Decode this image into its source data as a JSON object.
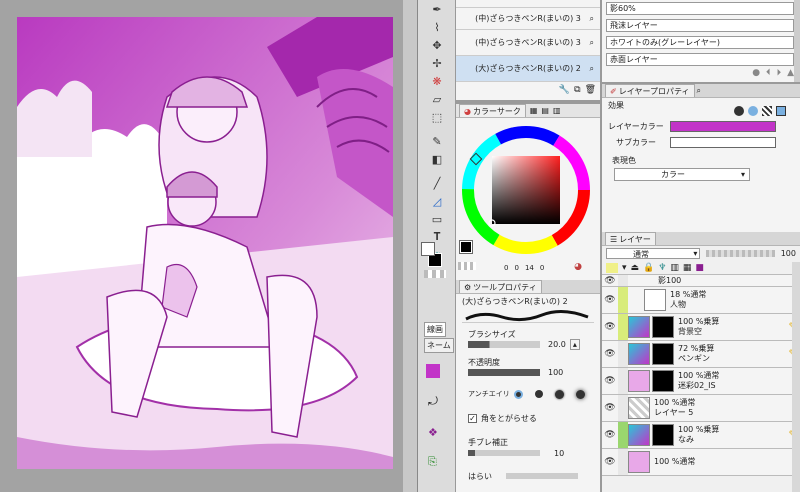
{
  "brush_list": {
    "items": [
      {
        "label": "(中)ざらつきペンR(まいの) 3"
      },
      {
        "label": "(大)ざらつきペンR(まいの) 2"
      }
    ]
  },
  "material_list": {
    "items": [
      "影60%",
      "飛沫レイヤー",
      "ホワイトのみ(グレーレイヤー)",
      "赤面レイヤー"
    ]
  },
  "color_circle": {
    "tab": "カラーサーク",
    "values": {
      "h": "0",
      "s": "0",
      "v": "14",
      "a": "0"
    }
  },
  "layer_property": {
    "tab": "レイヤープロパティ",
    "effect_label": "効果",
    "layer_color_label": "レイヤーカラー",
    "sub_color_label": "サブカラー",
    "expression_label": "表現色",
    "expression_value": "カラー",
    "layer_color": "#c234c8"
  },
  "layer_panel": {
    "tab": "レイヤー",
    "blend_mode": "通常",
    "opacity": "100",
    "layers": [
      {
        "name": "影100",
        "info": "",
        "strip": "#e8e8e8"
      },
      {
        "name": "人物",
        "info": "18 %通常",
        "strip": "#d8ec7a"
      },
      {
        "name": "背景空",
        "info": "100 %乗算",
        "strip": "#d8ec7a"
      },
      {
        "name": "ペンギン",
        "info": "72 %乗算",
        "strip": "#e8e8e8"
      },
      {
        "name": "迷彩02_IS",
        "info": "100 %通常",
        "strip": "#e8e8e8"
      },
      {
        "name": "レイヤー 5",
        "info": "100 %通常",
        "strip": "#e8e8e8"
      },
      {
        "name": "なみ",
        "info": "100 %乗算",
        "strip": "#9ad66e"
      },
      {
        "name": "",
        "info": "100 %通常",
        "strip": "#e8e8e8"
      }
    ]
  },
  "tool_property": {
    "tab": "ツールプロパティ",
    "tool_name": "(大)ざらつきペンR(まいの) 2",
    "brush_size_label": "ブラシサイズ",
    "brush_size_value": "20.0",
    "opacity_label": "不透明度",
    "opacity_value": "100",
    "antialias_label": "アンチエイリ",
    "corner_label": "角をとがらせる",
    "stabilizer_label": "手ブレ補正",
    "stabilizer_value": "10",
    "taper_label": "はらい"
  },
  "left_strip": {
    "tab1": "線画",
    "tab2": "ネーム"
  },
  "colors": {
    "main": "#000000",
    "accent_magenta": "#c234c8"
  }
}
